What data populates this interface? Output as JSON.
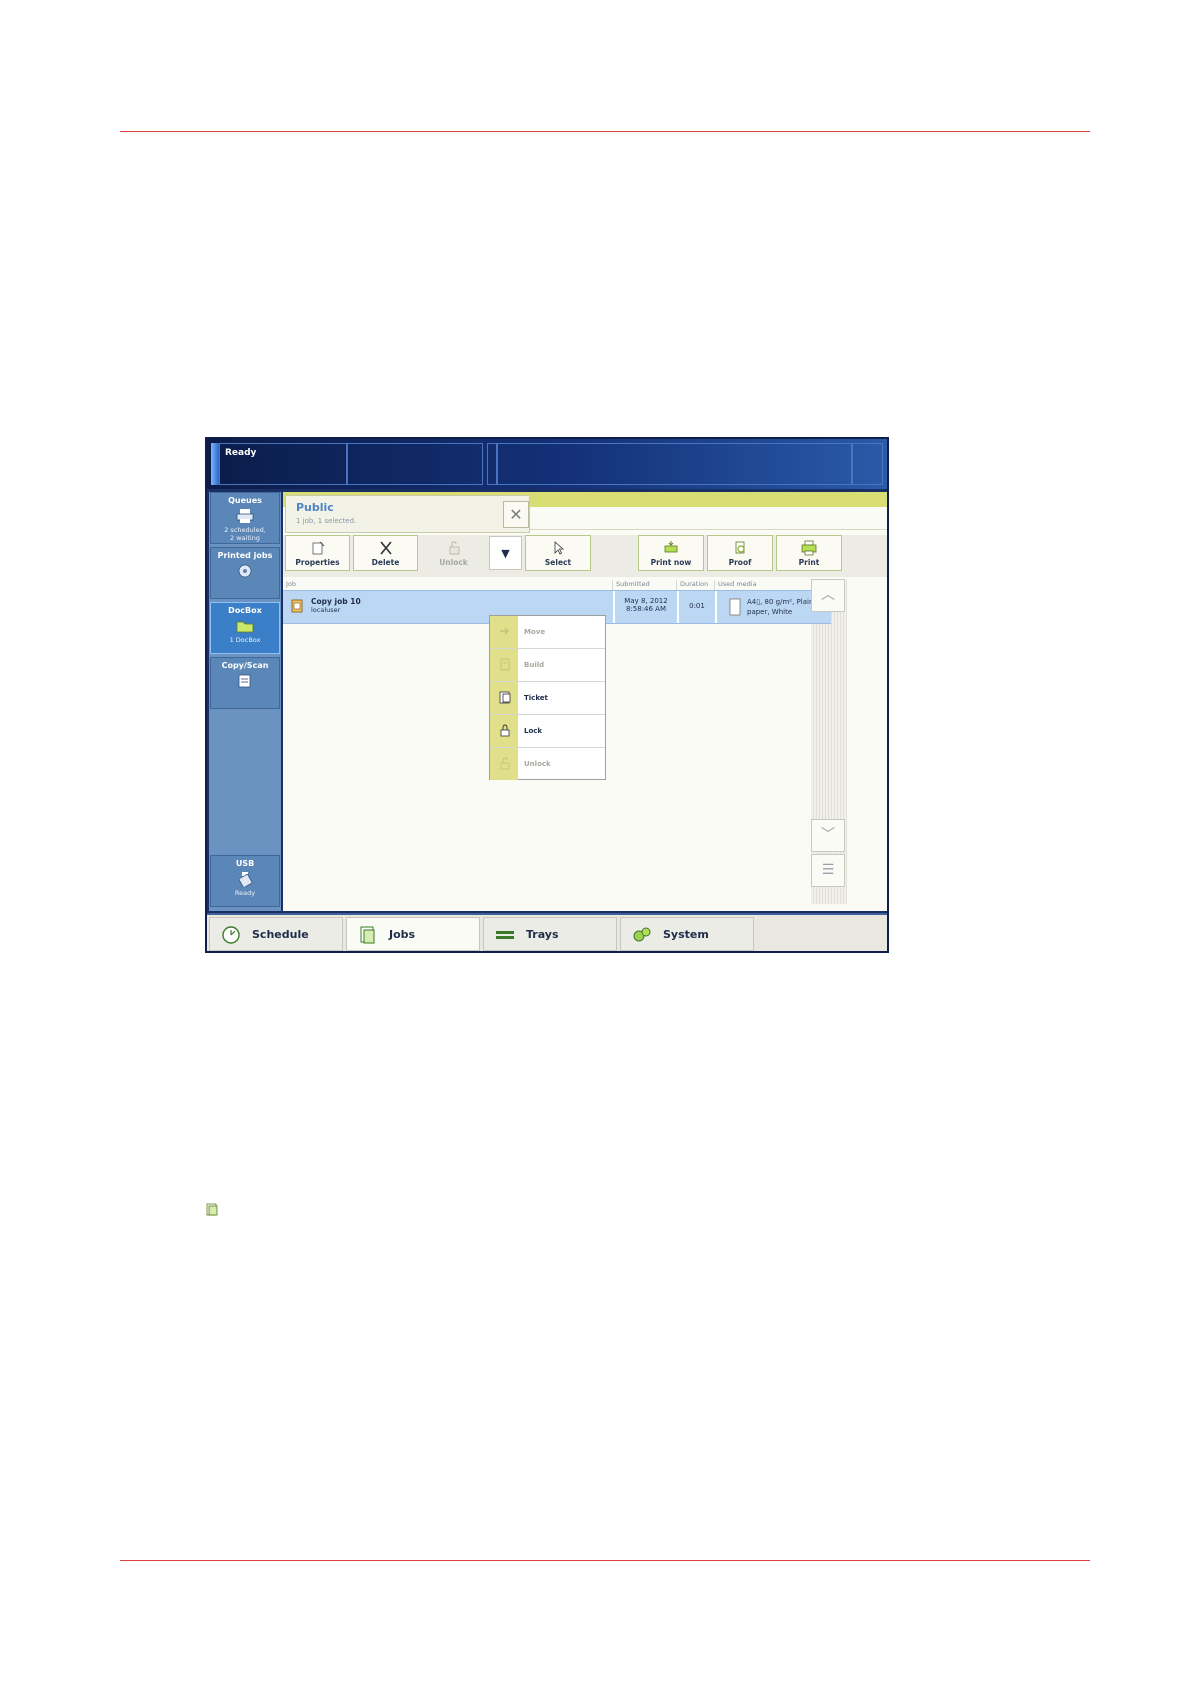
{
  "status": {
    "text": "Ready"
  },
  "sidebar": {
    "items": [
      {
        "label": "Queues",
        "sub1": "2 scheduled,",
        "sub2": "2 waiting"
      },
      {
        "label": "Printed jobs"
      },
      {
        "label": "DocBox",
        "sub1": "1 DocBox"
      },
      {
        "label": "Copy/Scan"
      },
      {
        "label": "USB",
        "sub1": "Ready"
      }
    ]
  },
  "panel": {
    "title": "Public",
    "subtitle": "1 job, 1 selected.",
    "close_glyph": "✕"
  },
  "toolbar": {
    "properties": "Properties",
    "delete": "Delete",
    "unlock": "Unlock",
    "select": "Select",
    "print_now": "Print now",
    "proof": "Proof",
    "print": "Print"
  },
  "table": {
    "columns": [
      "Job",
      "Submitted",
      "Duration",
      "Used media"
    ],
    "rows": [
      {
        "name": "Copy job 10",
        "owner": "localuser",
        "submitted_date": "May 8, 2012",
        "submitted_time": "8:58:46 AM",
        "duration": "0:01",
        "media_line1": "A4▯, 80 g/m², Plain",
        "media_line2": "paper, White"
      }
    ]
  },
  "menu": {
    "items": [
      {
        "label": "Move",
        "enabled": false
      },
      {
        "label": "Build",
        "enabled": false
      },
      {
        "label": "Ticket",
        "enabled": true
      },
      {
        "label": "Lock",
        "enabled": true
      },
      {
        "label": "Unlock",
        "enabled": false
      }
    ]
  },
  "tabs": [
    {
      "label": "Schedule"
    },
    {
      "label": "Jobs",
      "active": true
    },
    {
      "label": "Trays"
    },
    {
      "label": "System"
    }
  ],
  "colors": {
    "accent": "#d9423a",
    "status_bar": "#14327a",
    "sidebar": "#6a93c2",
    "selected_row": "#bcd7f3",
    "menu_strip": "#e0e08a"
  },
  "icons": [
    "printer-icon",
    "disc-icon",
    "folder-icon",
    "scanner-icon",
    "usb-icon",
    "properties-icon",
    "delete-icon",
    "unlock-icon",
    "cursor-icon",
    "print-now-icon",
    "proof-icon",
    "print-icon",
    "move-icon",
    "build-icon",
    "ticket-icon",
    "lock-icon",
    "clock-icon",
    "jobs-icon",
    "trays-icon",
    "gears-icon",
    "document-icon"
  ]
}
